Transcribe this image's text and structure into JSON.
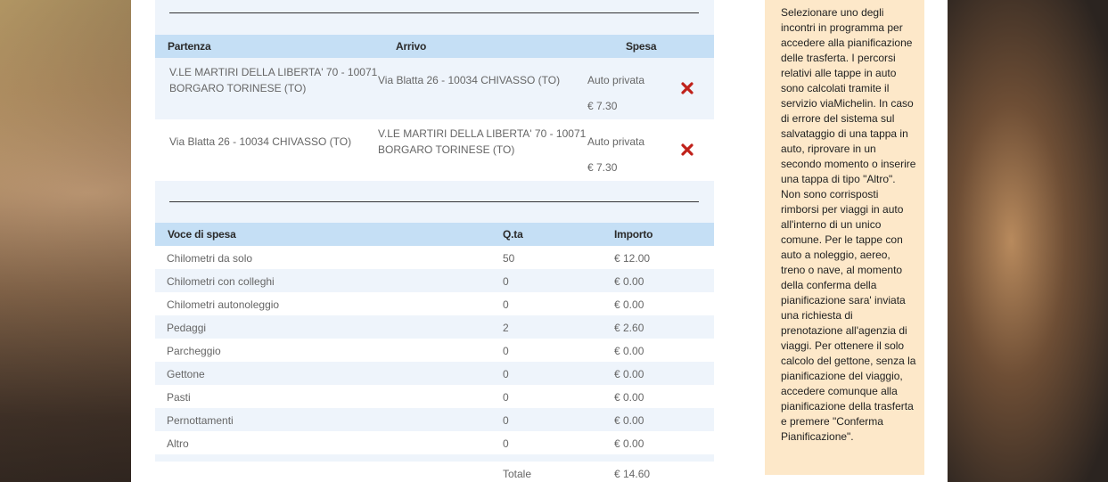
{
  "trips": {
    "headers": {
      "departure": "Partenza",
      "arrival": "Arrivo",
      "cost": "Spesa"
    },
    "rows": [
      {
        "departure": "V.LE MARTIRI DELLA LIBERTA' 70 - 10071 BORGARO TORINESE (TO)",
        "arrival": "Via Blatta 26 - 10034 CHIVASSO (TO)",
        "mode": "Auto privata",
        "amount": "€ 7.30"
      },
      {
        "departure": "Via Blatta 26 - 10034 CHIVASSO (TO)",
        "arrival": "V.LE MARTIRI DELLA LIBERTA' 70 - 10071 BORGARO TORINESE (TO)",
        "mode": "Auto privata",
        "amount": "€ 7.30"
      }
    ],
    "delete_icon": "red-x-icon"
  },
  "expenses": {
    "headers": {
      "item": "Voce di spesa",
      "qty": "Q.ta",
      "amount": "Importo"
    },
    "rows": [
      {
        "item": "Chilometri da solo",
        "qty": "50",
        "amount": "€ 12.00"
      },
      {
        "item": "Chilometri con colleghi",
        "qty": "0",
        "amount": "€ 0.00"
      },
      {
        "item": "Chilometri autonoleggio",
        "qty": "0",
        "amount": "€ 0.00"
      },
      {
        "item": "Pedaggi",
        "qty": "2",
        "amount": "€ 2.60"
      },
      {
        "item": "Parcheggio",
        "qty": "0",
        "amount": "€ 0.00"
      },
      {
        "item": "Gettone",
        "qty": "0",
        "amount": "€ 0.00"
      },
      {
        "item": "Pasti",
        "qty": "0",
        "amount": "€ 0.00"
      },
      {
        "item": "Pernottamenti",
        "qty": "0",
        "amount": "€ 0.00"
      },
      {
        "item": "Altro",
        "qty": "0",
        "amount": "€ 0.00"
      }
    ],
    "total_label": "Totale",
    "total_amount": "€ 14.60"
  },
  "sidebar": {
    "help_text": "Selezionare uno degli incontri in programma per accedere alla pianificazione delle trasferta. I percorsi relativi alle tappe in auto sono calcolati tramite il servizio viaMichelin. In caso di errore del sistema sul salvataggio di una tappa in auto, riprovare in un secondo momento o inserire una tappa di tipo \"Altro\". Non sono corrisposti rimborsi per viaggi in auto all'interno di un unico comune. Per le tappe con auto a noleggio, aereo, treno o nave, al momento della conferma della pianificazione sara' inviata una richiesta di prenotazione all'agenzia di viaggi. Per ottenere il solo calcolo del gettone, senza la pianificazione del viaggio, accedere comunque alla pianificazione della trasferta e premere \"Conferma Pianificazione\"."
  },
  "colors": {
    "header_bg": "#c5dff5",
    "row_alt_bg": "#eef4fb",
    "sidebar_bg": "#fde8c9",
    "delete_red": "#c0211a"
  }
}
